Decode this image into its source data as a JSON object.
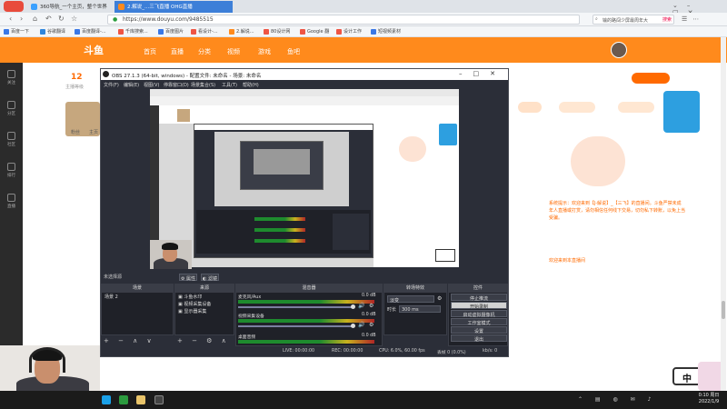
{
  "browser": {
    "tabs": [
      {
        "label": "360导航_一个主页，整个世界",
        "active": false
      },
      {
        "label": "2.解说_...三飞直播 OHG直播",
        "active": true
      }
    ],
    "url": "https://www.douyu.com/9485515",
    "search_placeholder": "输的路闯少屏最周年大",
    "search_button": "搜索",
    "bookmarks": [
      "百度一下",
      "谷歌翻译",
      "百度翻译-...",
      "千库搜索...",
      "百度图片",
      "看设计-...",
      "2.解说...",
      "80设计网",
      "Google 翻",
      "设计工作",
      "短视频素材"
    ]
  },
  "douyu": {
    "logo": "斗鱼",
    "nav": [
      "首页",
      "直播",
      "分类",
      "视频",
      "游戏",
      "鱼吧"
    ],
    "left_sidebar": [
      "关注",
      "分区",
      "社区",
      "排行",
      "直播",
      "赛事"
    ],
    "room_level": "12",
    "room_followers": "主播等级",
    "streamer_tags": [
      "粉丝",
      "主页"
    ],
    "chat_system_message": "系统提示：欢迎来到【J-解说】_【三飞】的直播间。斗鱼严禁未成年人直播或打赏，请勿相信任何线下交易，切勿私下转账，以免上当受骗。",
    "chat_welcome": "欢迎来到本直播间",
    "ime_indicator": "中"
  },
  "obs": {
    "title": "OBS 27.1.3 (64-bit, windows) - 配置文件: 未命名 - 场景: 未命名",
    "menu": [
      "文件(F)",
      "编辑(E)",
      "视图(V)",
      "停靠窗口(D)",
      "场景集合(S)",
      "工具(T)",
      "帮助(H)"
    ],
    "scene_label": "未选择源",
    "scene_buttons": [
      "属性",
      "滤镜"
    ],
    "docks": {
      "scenes": {
        "header": "场景",
        "items": [
          "场景 2"
        ]
      },
      "sources": {
        "header": "来源",
        "items": [
          "斗鱼水印",
          "视频采集设备",
          "显示器采集"
        ]
      },
      "mixer": {
        "header": "混音器",
        "channels": [
          {
            "name": "麦克风/Aux",
            "db": "0.0 dB"
          },
          {
            "name": "视频采集设备",
            "db": "0.0 dB"
          },
          {
            "name": "桌面音频",
            "db": "0.0 dB"
          }
        ]
      },
      "transitions": {
        "header": "转场特效",
        "type": "淡变",
        "duration_label": "时长",
        "duration_value": "300 ms"
      },
      "controls": {
        "header": "控件",
        "buttons": [
          "停止推流",
          "开始录制",
          "启动虚拟摄像机",
          "工作室模式",
          "设置",
          "退出"
        ]
      }
    },
    "status_bar": {
      "live": "LIVE: 00:00:00",
      "rec": "REC: 00:00:00",
      "cpu": "CPU: 6.0%, 60.00 fps",
      "dropped": "丢帧 0 (0.0%)",
      "bitrate": "kb/s: 0"
    }
  },
  "taskbar": {
    "time": "0:10 周日",
    "date": "2022/1/9"
  }
}
